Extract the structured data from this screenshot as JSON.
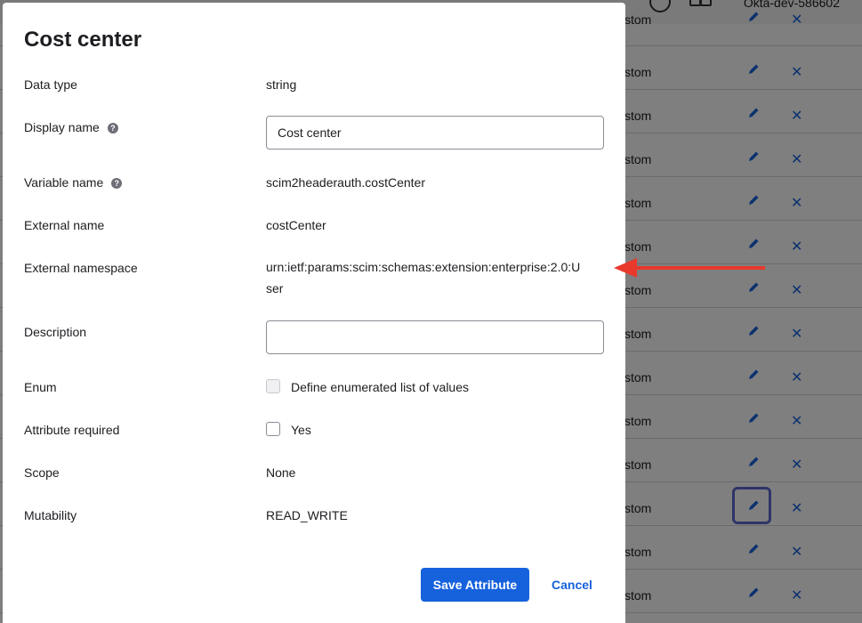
{
  "background": {
    "org_name": "Okta-dev-586602",
    "rows": [
      {
        "type_text": "stom",
        "top": 0
      },
      {
        "type_text": "stom"
      },
      {
        "type_text": "stom"
      },
      {
        "type_text": "stom"
      },
      {
        "type_text": "stom"
      },
      {
        "type_text": "stom"
      },
      {
        "type_text": "stom"
      },
      {
        "type_text": "stom"
      },
      {
        "type_text": "stom"
      },
      {
        "type_text": "stom"
      },
      {
        "type_text": "stom"
      },
      {
        "type_text": "stom"
      },
      {
        "type_text": "stom"
      },
      {
        "type_text": "stom"
      }
    ],
    "delete_glyph": "✕"
  },
  "modal": {
    "title": "Cost center",
    "fields": {
      "data_type": {
        "label": "Data type",
        "value": "string"
      },
      "display_name": {
        "label": "Display name",
        "value": "Cost center"
      },
      "variable_name": {
        "label": "Variable name",
        "value": "scim2headerauth.costCenter"
      },
      "external_name": {
        "label": "External name",
        "value": "costCenter"
      },
      "external_namespace": {
        "label": "External namespace",
        "value": "urn:ietf:params:scim:schemas:extension:enterprise:2.0:User"
      },
      "description": {
        "label": "Description",
        "value": ""
      },
      "enum": {
        "label": "Enum",
        "checkbox_label": "Define enumerated list of values"
      },
      "attribute_required": {
        "label": "Attribute required",
        "checkbox_label": "Yes"
      },
      "scope": {
        "label": "Scope",
        "value": "None"
      },
      "mutability": {
        "label": "Mutability",
        "value": "READ_WRITE"
      }
    },
    "help_glyph": "?",
    "buttons": {
      "save": "Save Attribute",
      "cancel": "Cancel"
    }
  },
  "colors": {
    "primary": "#1662dd",
    "annotation_arrow": "#e8392c",
    "focus_ring": "#5e6bd1"
  }
}
